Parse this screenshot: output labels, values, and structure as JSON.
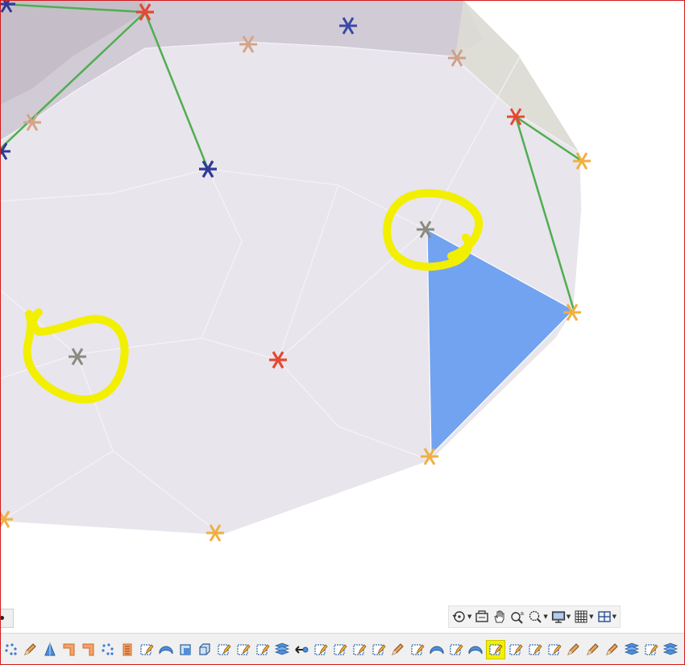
{
  "colors": {
    "background": "#ffffff",
    "mesh_fill": "#e7e4ea",
    "mesh_fill_dark": "#cbc5d0",
    "mesh_edge": "#ffffff",
    "green_link": "#4fae4f",
    "marker_blue": "#2e3a96",
    "marker_red": "#e34a33",
    "marker_orange": "#f0b040",
    "marker_tan": "#d6a488",
    "marker_gray": "#8a8a80",
    "selected_face": "#72a3f1",
    "highlight_yellow": "#f2ef00",
    "window_border": "#d11a1a"
  },
  "viewport": {
    "selected_face": "triangle-face",
    "annotations": [
      "highlight-circle",
      "highlight-circle"
    ]
  },
  "view_toolbar": {
    "items": [
      {
        "icon": "rotate-view-icon",
        "dropdown": true
      },
      {
        "icon": "fit-view-icon",
        "dropdown": false
      },
      {
        "icon": "pan-hand-icon",
        "dropdown": false
      },
      {
        "icon": "zoom-icon",
        "dropdown": false
      },
      {
        "icon": "zoom-window-icon",
        "dropdown": true
      },
      {
        "icon": "display-monitor-icon",
        "dropdown": true
      },
      {
        "icon": "grid-icon",
        "dropdown": true
      },
      {
        "icon": "layout-icon",
        "dropdown": true
      }
    ]
  },
  "bottom_toolbar": {
    "selected_index": 25,
    "items": [
      "points-dots-icon",
      "pencil-edit-icon",
      "cone-icon",
      "orange-bracket-icon",
      "orange-bracket-icon",
      "points-dots-icon",
      "orange-scale-icon",
      "sketch-edit-icon",
      "blue-surface-icon",
      "box-front-icon",
      "box-corner-icon",
      "sketch-edit-icon",
      "sketch-edit-icon",
      "sketch-edit-icon",
      "layers-icon",
      "arrow-left-icon",
      "sketch-edit-icon",
      "sketch-edit-icon",
      "sketch-edit-icon",
      "sketch-edit-icon",
      "pencil-edit-icon",
      "sketch-edit-icon",
      "blue-surface-icon",
      "sketch-edit-icon",
      "blue-surface-icon",
      "sketch-edit-icon",
      "sketch-edit-icon",
      "sketch-edit-icon",
      "sketch-edit-icon",
      "pencil-edit-icon",
      "pencil-edit-icon",
      "pencil-edit-icon",
      "layers-icon",
      "sketch-edit-icon",
      "layers-icon"
    ]
  }
}
